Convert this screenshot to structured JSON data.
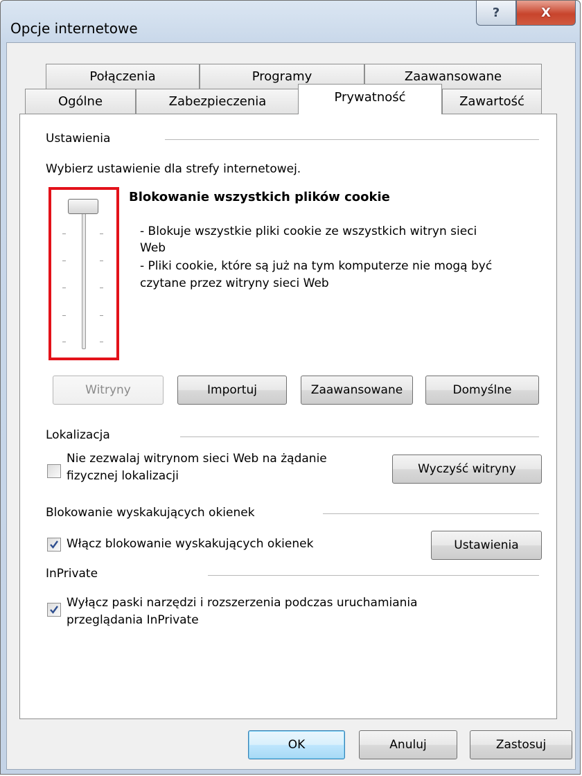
{
  "window": {
    "title": "Opcje internetowe",
    "help_label": "?",
    "close_label": "X"
  },
  "tabs": {
    "row1": [
      "Połączenia",
      "Programy",
      "Zaawansowane"
    ],
    "row2": [
      "Ogólne",
      "Zabezpieczenia",
      "Prywatność",
      "Zawartość"
    ],
    "selected": "Prywatność"
  },
  "settings": {
    "group_title": "Ustawienia",
    "instruction": "Wybierz ustawienie dla strefy internetowej.",
    "slider_level_label": "Blokowanie wszystkich plików cookie",
    "slider_position": 1,
    "slider_positions_total": 6,
    "description_line1": "- Blokuje wszystkie pliki cookie ze wszystkich witryn sieci",
    "description_line2": "Web",
    "description_line3": "- Pliki cookie, które są już na tym komputerze nie mogą być",
    "description_line4": "czytane przez witryny sieci Web",
    "buttons": {
      "sites": "Witryny",
      "import": "Importuj",
      "advanced": "Zaawansowane",
      "default": "Domyślne"
    }
  },
  "location": {
    "group_title": "Lokalizacja",
    "checkbox_line1": "Nie zezwalaj witrynom sieci Web na żądanie",
    "checkbox_line2": "fizycznej lokalizacji",
    "checked": false,
    "clear_button": "Wyczyść witryny"
  },
  "popup": {
    "group_title": "Blokowanie wyskakujących okienek",
    "checkbox_label": "Włącz blokowanie wyskakujących okienek",
    "checked": true,
    "settings_button": "Ustawienia"
  },
  "inprivate": {
    "group_title": "InPrivate",
    "checkbox_line1": "Wyłącz paski narzędzi i rozszerzenia podczas uruchamiania",
    "checkbox_line2": "przeglądania InPrivate",
    "checked": true
  },
  "footer": {
    "ok": "OK",
    "cancel": "Anuluj",
    "apply": "Zastosuj"
  },
  "colors": {
    "highlight": "#e3121a",
    "close_button": "#c8442c",
    "focus_border": "#3c7fb1"
  }
}
